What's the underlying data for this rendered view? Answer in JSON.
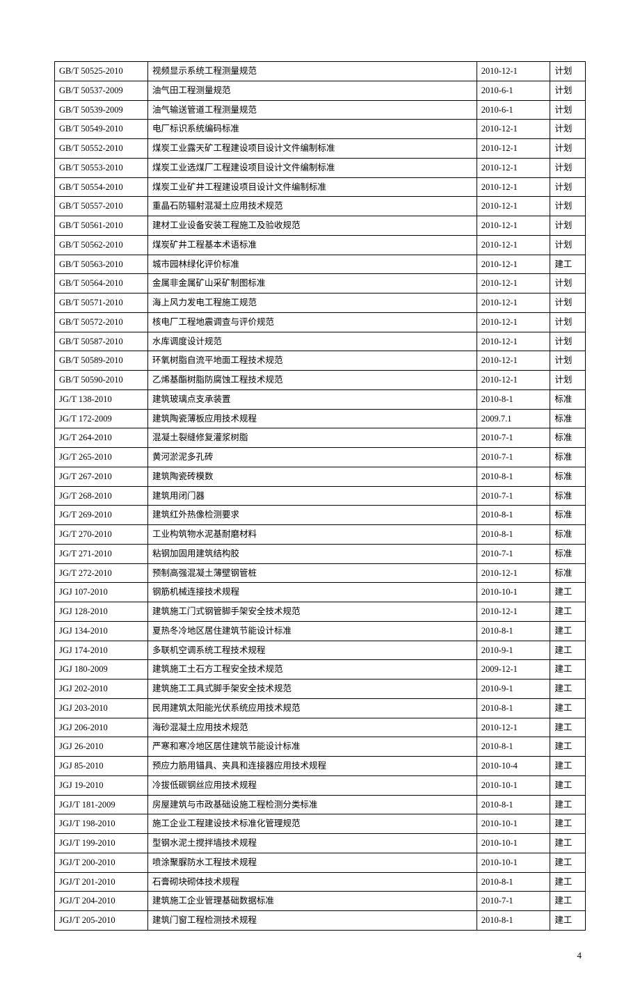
{
  "page_number": "4",
  "rows": [
    {
      "code": "GB/T 50525-2010",
      "name": "视频显示系统工程测量规范",
      "date": "2010-12-1",
      "cat": "计划"
    },
    {
      "code": "GB/T 50537-2009",
      "name": "油气田工程测量规范",
      "date": "2010-6-1",
      "cat": "计划"
    },
    {
      "code": "GB/T 50539-2009",
      "name": "油气输送管道工程测量规范",
      "date": "2010-6-1",
      "cat": "计划"
    },
    {
      "code": "GB/T 50549-2010",
      "name": "电厂标识系统编码标准",
      "date": "2010-12-1",
      "cat": "计划"
    },
    {
      "code": "GB/T 50552-2010",
      "name": "煤炭工业露天矿工程建设项目设计文件编制标准",
      "date": "2010-12-1",
      "cat": "计划"
    },
    {
      "code": "GB/T 50553-2010",
      "name": "煤炭工业选煤厂工程建设项目设计文件编制标准",
      "date": "2010-12-1",
      "cat": "计划"
    },
    {
      "code": "GB/T 50554-2010",
      "name": "煤炭工业矿井工程建设项目设计文件编制标准",
      "date": "2010-12-1",
      "cat": "计划"
    },
    {
      "code": "GB/T 50557-2010",
      "name": "重晶石防辐射混凝土应用技术规范",
      "date": "2010-12-1",
      "cat": "计划"
    },
    {
      "code": "GB/T 50561-2010",
      "name": "建材工业设备安装工程施工及验收规范",
      "date": "2010-12-1",
      "cat": "计划"
    },
    {
      "code": "GB/T 50562-2010",
      "name": "煤炭矿井工程基本术语标准",
      "date": "2010-12-1",
      "cat": "计划"
    },
    {
      "code": "GB/T 50563-2010",
      "name": "城市园林绿化评价标准",
      "date": "2010-12-1",
      "cat": "建工"
    },
    {
      "code": "GB/T 50564-2010",
      "name": "金属非金属矿山采矿制图标准",
      "date": "2010-12-1",
      "cat": "计划"
    },
    {
      "code": "GB/T 50571-2010",
      "name": "海上风力发电工程施工规范",
      "date": "2010-12-1",
      "cat": "计划"
    },
    {
      "code": "GB/T 50572-2010",
      "name": "核电厂工程地震调查与评价规范",
      "date": "2010-12-1",
      "cat": "计划"
    },
    {
      "code": "GB/T 50587-2010",
      "name": "水库调度设计规范",
      "date": "2010-12-1",
      "cat": "计划"
    },
    {
      "code": "GB/T 50589-2010",
      "name": "环氧树脂自流平地面工程技术规范",
      "date": "2010-12-1",
      "cat": "计划"
    },
    {
      "code": "GB/T 50590-2010",
      "name": "乙烯基酯树脂防腐蚀工程技术规范",
      "date": "2010-12-1",
      "cat": "计划"
    },
    {
      "code": "JG/T 138-2010",
      "name": "建筑玻璃点支承装置",
      "date": "2010-8-1",
      "cat": "标准"
    },
    {
      "code": "JG/T 172-2009",
      "name": "建筑陶瓷薄板应用技术规程",
      "date": "2009.7.1",
      "cat": "标准"
    },
    {
      "code": "JG/T 264-2010",
      "name": "混凝土裂缝修复灌浆树脂",
      "date": "2010-7-1",
      "cat": "标准"
    },
    {
      "code": "JG/T 265-2010",
      "name": "黄河淤泥多孔砖",
      "date": "2010-7-1",
      "cat": "标准"
    },
    {
      "code": "JG/T 267-2010",
      "name": "建筑陶瓷砖模数",
      "date": "2010-8-1",
      "cat": "标准"
    },
    {
      "code": "JG/T 268-2010",
      "name": "建筑用闭门器",
      "date": "2010-7-1",
      "cat": "标准"
    },
    {
      "code": "JG/T 269-2010",
      "name": "建筑红外热像检测要求",
      "date": "2010-8-1",
      "cat": "标准"
    },
    {
      "code": "JG/T 270-2010",
      "name": "工业构筑物水泥基耐磨材料",
      "date": "2010-8-1",
      "cat": "标准"
    },
    {
      "code": "JG/T 271-2010",
      "name": "粘钢加固用建筑结构胶",
      "date": "2010-7-1",
      "cat": "标准"
    },
    {
      "code": "JG/T 272-2010",
      "name": "预制高强混凝土薄壁钢管桩",
      "date": "2010-12-1",
      "cat": "标准"
    },
    {
      "code": "JGJ 107-2010",
      "name": "钢筋机械连接技术规程",
      "date": "2010-10-1",
      "cat": "建工"
    },
    {
      "code": "JGJ 128-2010",
      "name": "建筑施工门式钢管脚手架安全技术规范",
      "date": "2010-12-1",
      "cat": "建工"
    },
    {
      "code": "JGJ 134-2010",
      "name": "夏热冬冷地区居住建筑节能设计标准",
      "date": "2010-8-1",
      "cat": "建工"
    },
    {
      "code": "JGJ 174-2010",
      "name": "多联机空调系统工程技术规程",
      "date": "2010-9-1",
      "cat": "建工"
    },
    {
      "code": "JGJ 180-2009",
      "name": "建筑施工土石方工程安全技术规范",
      "date": "2009-12-1",
      "cat": "建工"
    },
    {
      "code": "JGJ 202-2010",
      "name": "建筑施工工具式脚手架安全技术规范",
      "date": "2010-9-1",
      "cat": "建工"
    },
    {
      "code": "JGJ 203-2010",
      "name": "民用建筑太阳能光伏系统应用技术规范",
      "date": "2010-8-1",
      "cat": "建工"
    },
    {
      "code": "JGJ 206-2010",
      "name": "海砂混凝土应用技术规范",
      "date": "2010-12-1",
      "cat": "建工"
    },
    {
      "code": "JGJ 26-2010",
      "name": "严寒和寒冷地区居住建筑节能设计标准",
      "date": "2010-8-1",
      "cat": "建工"
    },
    {
      "code": "JGJ 85-2010",
      "name": "预应力筋用锚具、夹具和连接器应用技术规程",
      "date": "2010-10-4",
      "cat": "建工"
    },
    {
      "code": "JGJ 19-2010",
      "name": "冷拔低碳钢丝应用技术规程",
      "date": "2010-10-1",
      "cat": "建工"
    },
    {
      "code": "JGJ/T 181-2009",
      "name": "房屋建筑与市政基础设施工程检测分类标准",
      "date": "2010-8-1",
      "cat": "建工"
    },
    {
      "code": "JGJ/T 198-2010",
      "name": "施工企业工程建设技术标准化管理规范",
      "date": "2010-10-1",
      "cat": "建工"
    },
    {
      "code": "JGJ/T 199-2010",
      "name": "型钢水泥土搅拌墙技术规程",
      "date": "2010-10-1",
      "cat": "建工"
    },
    {
      "code": "JGJ/T 200-2010",
      "name": "喷涂聚脲防水工程技术规程",
      "date": "2010-10-1",
      "cat": "建工"
    },
    {
      "code": "JGJ/T 201-2010",
      "name": "石膏砌块砌体技术规程",
      "date": "2010-8-1",
      "cat": "建工"
    },
    {
      "code": "JGJ/T 204-2010",
      "name": "建筑施工企业管理基础数据标准",
      "date": "2010-7-1",
      "cat": "建工"
    },
    {
      "code": "JGJ/T 205-2010",
      "name": "建筑门窗工程检测技术规程",
      "date": "2010-8-1",
      "cat": "建工"
    }
  ]
}
